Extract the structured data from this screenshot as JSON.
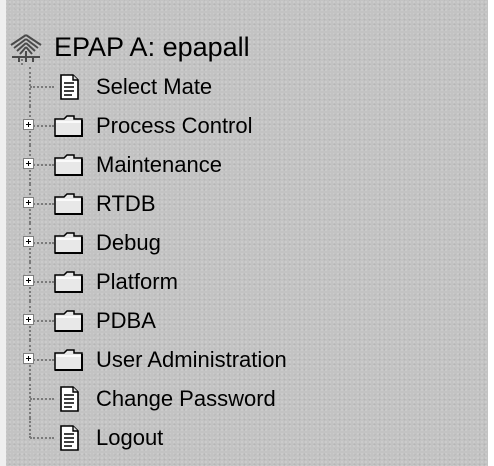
{
  "tree": {
    "root": {
      "label": "EPAP A: epapall",
      "icon": "tree-root-icon"
    },
    "items": [
      {
        "label": "Select Mate",
        "type": "page",
        "icon": "document-icon",
        "expandable": false
      },
      {
        "label": "Process Control",
        "type": "folder",
        "icon": "folder-icon",
        "expandable": true
      },
      {
        "label": "Maintenance",
        "type": "folder",
        "icon": "folder-icon",
        "expandable": true
      },
      {
        "label": "RTDB",
        "type": "folder",
        "icon": "folder-icon",
        "expandable": true
      },
      {
        "label": "Debug",
        "type": "folder",
        "icon": "folder-icon",
        "expandable": true
      },
      {
        "label": "Platform",
        "type": "folder",
        "icon": "folder-icon",
        "expandable": true
      },
      {
        "label": "PDBA",
        "type": "folder",
        "icon": "folder-icon",
        "expandable": true
      },
      {
        "label": "User Administration",
        "type": "folder",
        "icon": "folder-icon",
        "expandable": true
      },
      {
        "label": "Change Password",
        "type": "page",
        "icon": "document-icon",
        "expandable": false
      },
      {
        "label": "Logout",
        "type": "page",
        "icon": "document-icon",
        "expandable": false
      }
    ]
  },
  "colors": {
    "panel_background": "#c3c3c3",
    "text": "#000000",
    "connector": "#7a7a7a"
  }
}
